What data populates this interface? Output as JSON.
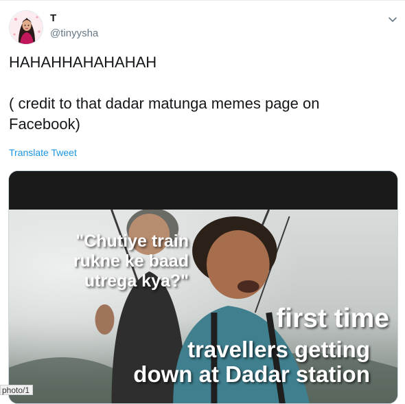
{
  "tweet": {
    "display_name": "T",
    "handle": "@tinyysha",
    "text": "HAHAHHAHAHAHAH\n\n( credit to that dadar matunga memes page on Facebook)",
    "translate_label": "Translate Tweet"
  },
  "media": {
    "caption_quote": "\"Chutiye train\nrukne ke baad\nutrega kya?\"",
    "caption_line1": "first time",
    "caption_line2": "travellers getting\ndown at Dadar station"
  },
  "status_bar": {
    "url_fragment": "photo/1"
  },
  "colors": {
    "link": "#1b95e0",
    "secondary": "#657786",
    "text": "#14171a"
  },
  "icons": {
    "menu": "chevron-down-icon",
    "avatar": "avatar-illustration"
  }
}
